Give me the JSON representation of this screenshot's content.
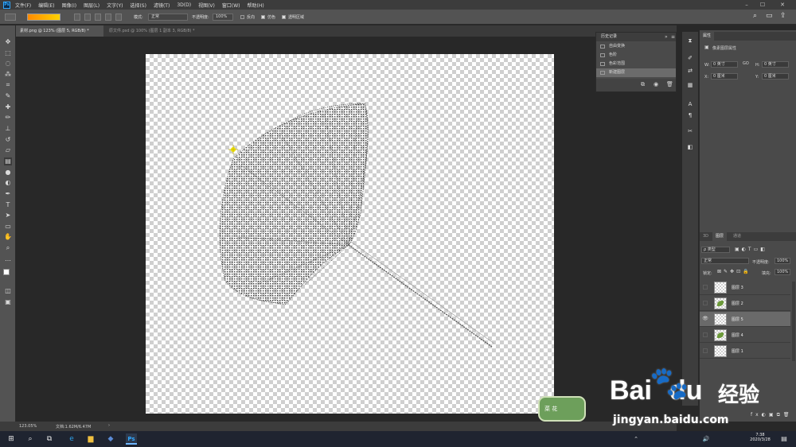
{
  "app": {
    "name": "Ps"
  },
  "menu": [
    "文件(F)",
    "编辑(E)",
    "图像(I)",
    "图层(L)",
    "文字(Y)",
    "选择(S)",
    "滤镜(T)",
    "3D(D)",
    "视图(V)",
    "窗口(W)",
    "帮助(H)"
  ],
  "options": {
    "mode_label": "模式:",
    "mode_value": "正常",
    "opacity_label": "不透明度:",
    "opacity_value": "100%",
    "reverse_label": "反向",
    "dither_label": "仿色",
    "transparency_label": "透明区域"
  },
  "tabs": [
    {
      "label": "素材.png @ 123% (图层 5, RGB/8) *"
    },
    {
      "label": "原文件.psd @ 100% (图层 1 副本 3, RGB/8) *"
    }
  ],
  "status": {
    "zoom": "123.05%",
    "doc": "文档:1.62M/6.47M"
  },
  "history": {
    "title": "历史记录",
    "items": [
      {
        "label": "自由变换"
      },
      {
        "label": "色阶"
      },
      {
        "label": "色彩范围"
      },
      {
        "label": "新建图层"
      }
    ]
  },
  "properties": {
    "title": "属性",
    "subtitle": "像素图层属性",
    "w_label": "W:",
    "w_value": "0 英寸",
    "h_label": "H:",
    "h_value": "0 英寸",
    "go_label": "GO",
    "x_label": "X:",
    "x_value": "0 厘米",
    "y_label": "Y:",
    "y_value": "0 厘米"
  },
  "layers_panel": {
    "tabs": [
      "3D",
      "图层",
      "通道"
    ],
    "filter_label": "ρ 类型",
    "blend_mode": "正常",
    "opacity_label": "不透明度:",
    "opacity_value": "100%",
    "lock_label": "锁定:",
    "fill_label": "填充:",
    "fill_value": "100%",
    "layers": [
      {
        "name": "图层 3",
        "visible": false,
        "selected": false,
        "thumb": "empty"
      },
      {
        "name": "图层 2",
        "visible": false,
        "selected": false,
        "thumb": "leaf"
      },
      {
        "name": "图层 5",
        "visible": true,
        "selected": true,
        "thumb": "empty"
      },
      {
        "name": "图层 4",
        "visible": false,
        "selected": false,
        "thumb": "leaf"
      },
      {
        "name": "图层 1",
        "visible": false,
        "selected": false,
        "thumb": "empty"
      }
    ]
  },
  "taskbar": {
    "time": "7:38",
    "date": "2020/3/28"
  },
  "watermark": {
    "badge_text": "菜 花",
    "brand_cn": "经验",
    "brand_latin": "Bai",
    "brand_latin_2": "du",
    "url": "jingyan.baidu.com"
  },
  "colors": {
    "accent": "#31a8ff",
    "panel": "#535353",
    "bg": "#282828",
    "selected_layer": "#6a6a6a",
    "leaf_green": "#6c9a3a",
    "gradient_start": "#ff8a00",
    "gradient_end": "#ffd300"
  }
}
